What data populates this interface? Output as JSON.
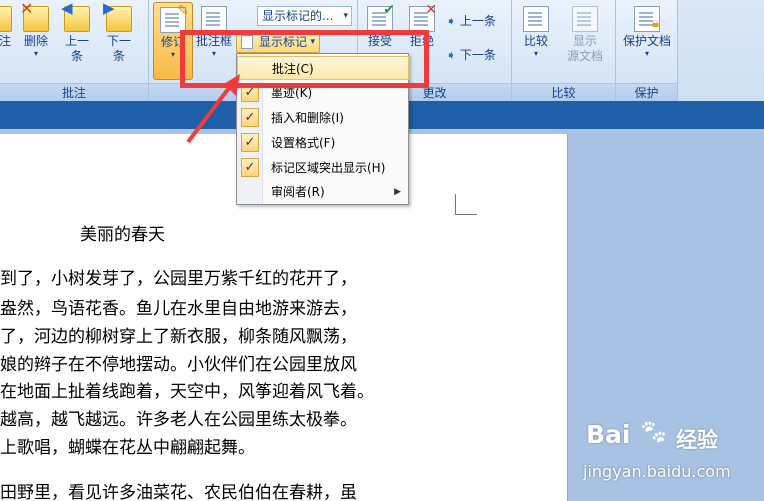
{
  "ribbon": {
    "groups": {
      "comments": "批注",
      "tracking": "",
      "changes": "更改",
      "compare": "比较",
      "protect": "保护"
    },
    "buttons": {
      "comment_partial": "注",
      "delete": "删除",
      "prev_line1": "上一",
      "prev_line2": "条",
      "next_line1": "下一",
      "next_line2": "条",
      "track": "修订",
      "balloons": "批注框",
      "accept": "接受",
      "reject": "拒绝",
      "prev_change": "上一条",
      "next_change": "下一条",
      "compare": "比较",
      "show_source_line1": "显示",
      "show_source_line2": "源文档",
      "protect_doc": "保护文档",
      "show_markup": "显示标记",
      "display_for_review": "显示标记的..."
    }
  },
  "markup_menu": {
    "items": [
      {
        "label": "批注(C)",
        "checked": false,
        "hover": true
      },
      {
        "label": "墨迹(K)",
        "checked": true,
        "hover": false
      },
      {
        "label": "插入和删除(I)",
        "checked": true,
        "hover": false
      },
      {
        "label": "设置格式(F)",
        "checked": true,
        "hover": false
      },
      {
        "label": "标记区域突出显示(H)",
        "checked": true,
        "hover": false
      },
      {
        "label": "审阅者(R)",
        "checked": false,
        "hover": false,
        "submenu": true
      }
    ],
    "check_glyph": "✓",
    "submenu_glyph": "▶"
  },
  "document": {
    "title": "美丽的春天",
    "lines": [
      "到了，小树发芽了，公园里万紫千红的花开了，",
      "盎然，鸟语花香。鱼儿在水里自由地游来游去，",
      "了，河边的柳树穿上了新衣服，柳条随风飘荡，",
      "娘的辫子在不停地摆动。小伙伴们在公园里放风",
      "在地面上扯着线跑着，天空中，风筝迎着风飞着。",
      "越高，越飞越远。许多老人在公园里练太极拳。",
      "上歌唱，蝴蝶在花丛中翩翩起舞。",
      "田野里，看见许多油菜花、农民伯伯在春耕，虽"
    ]
  },
  "watermark": {
    "brand": "Bai",
    "brand_suffix": "经验",
    "url": "jingyan.baidu.com"
  },
  "colors": {
    "annotation": "#ef3b3b",
    "ribbon_text": "#15428b",
    "band": "#1f5fa7"
  }
}
